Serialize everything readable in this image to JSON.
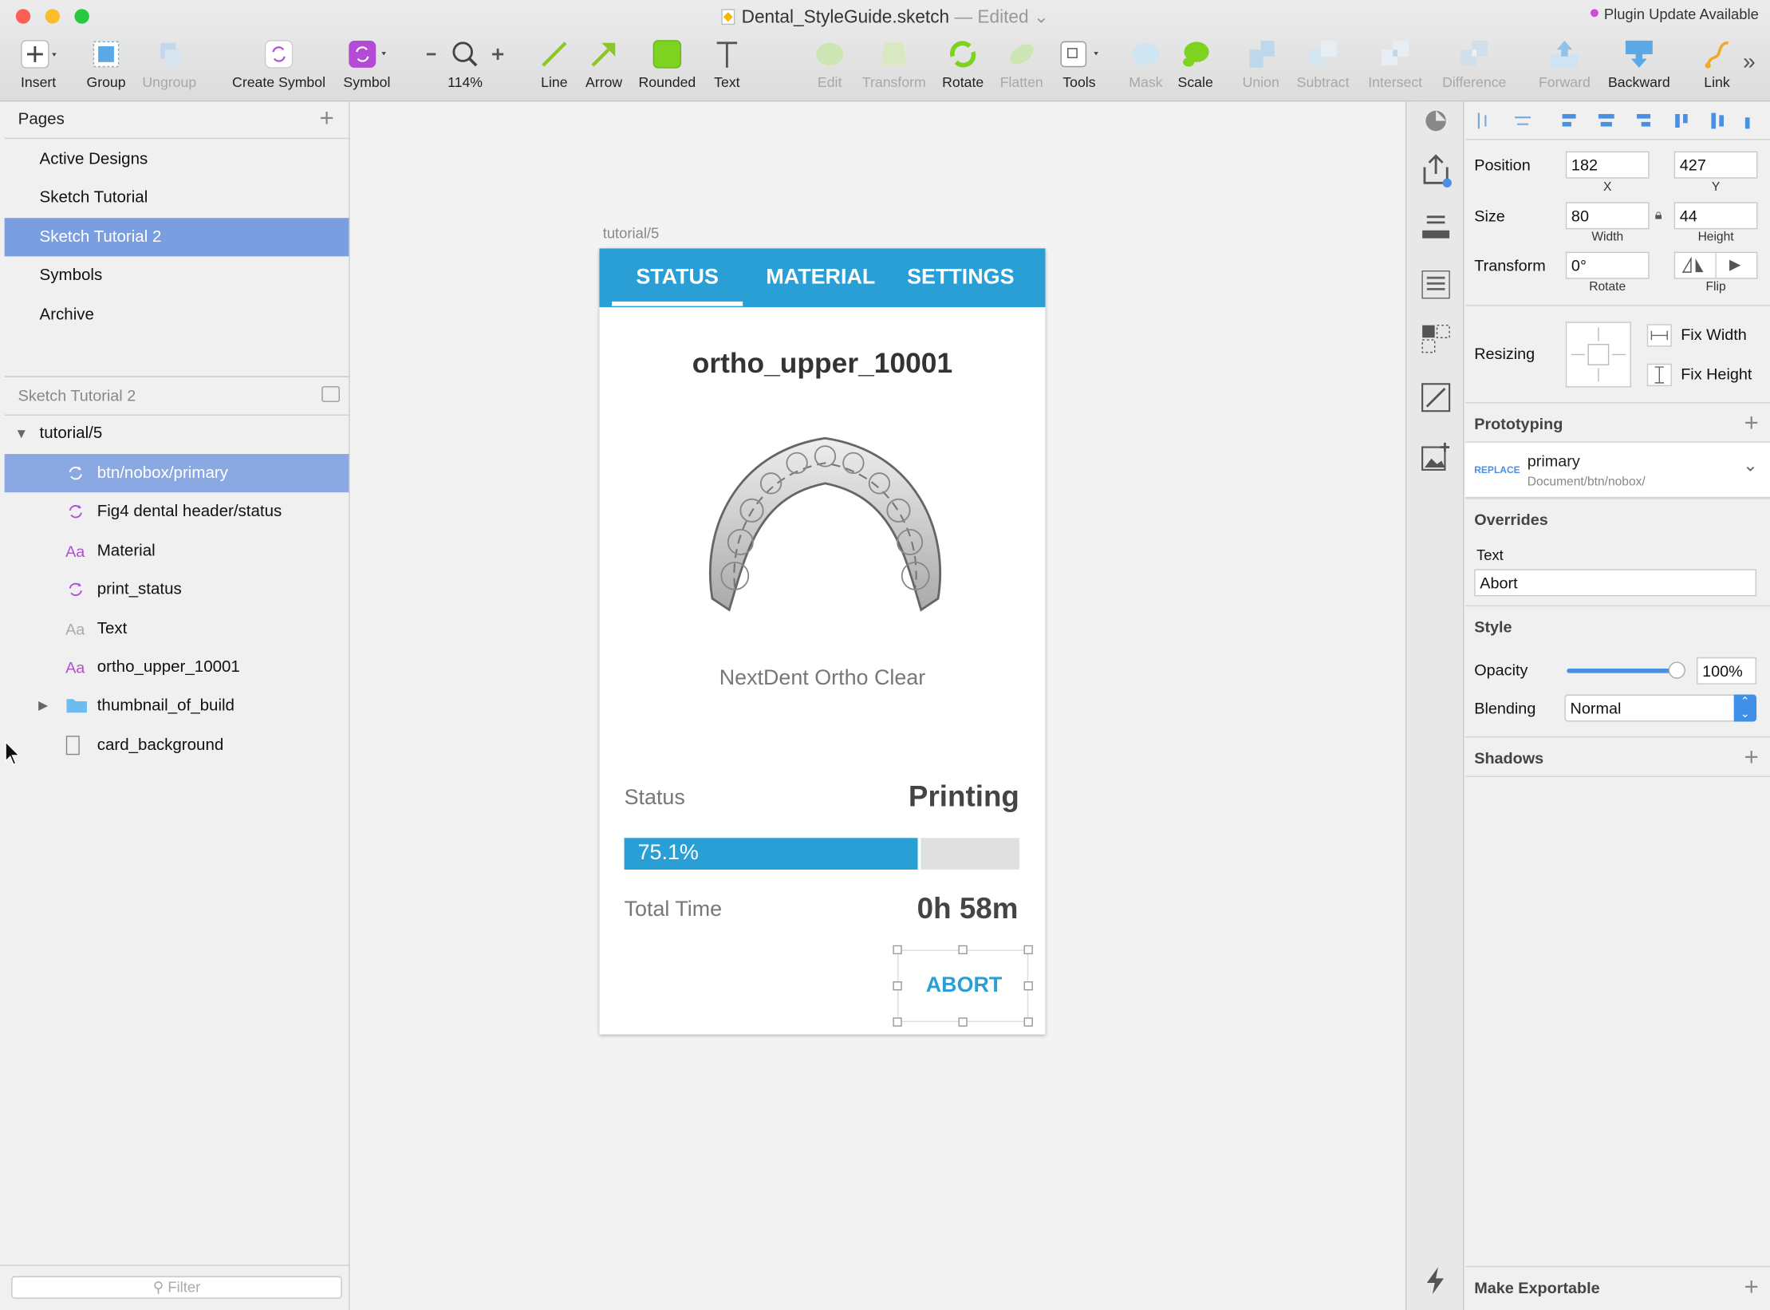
{
  "window": {
    "title": "Dental_StyleGuide.sketch",
    "status": "— Edited",
    "plugin_notice": "Plugin Update Available"
  },
  "toolbar": {
    "insert": "Insert",
    "group": "Group",
    "ungroup": "Ungroup",
    "create_symbol": "Create Symbol",
    "symbol": "Symbol",
    "zoom": "114%",
    "line": "Line",
    "arrow": "Arrow",
    "rounded": "Rounded",
    "text": "Text",
    "edit": "Edit",
    "transform": "Transform",
    "rotate": "Rotate",
    "flatten": "Flatten",
    "tools": "Tools",
    "mask": "Mask",
    "scale": "Scale",
    "union": "Union",
    "subtract": "Subtract",
    "intersect": "Intersect",
    "difference": "Difference",
    "forward": "Forward",
    "backward": "Backward",
    "link": "Link"
  },
  "pages": {
    "header": "Pages",
    "items": [
      "Active Designs",
      "Sketch Tutorial",
      "Sketch Tutorial 2",
      "Symbols",
      "Archive"
    ],
    "selected": "Sketch Tutorial 2"
  },
  "layers": {
    "header": "Sketch Tutorial 2",
    "artboard": "tutorial/5",
    "items": [
      {
        "name": "btn/nobox/primary",
        "icon": "symbol-instance-icon"
      },
      {
        "name": "Fig4 dental header/status",
        "icon": "symbol-instance-icon"
      },
      {
        "name": "Material",
        "icon": "text-layer-icon"
      },
      {
        "name": "print_status",
        "icon": "symbol-instance-icon"
      },
      {
        "name": "Text",
        "icon": "text-layer-icon"
      },
      {
        "name": "ortho_upper_10001",
        "icon": "text-layer-icon"
      },
      {
        "name": "thumbnail_of_build",
        "icon": "folder-icon"
      },
      {
        "name": "card_background",
        "icon": "rectangle-icon"
      }
    ],
    "filter_placeholder": "Filter"
  },
  "artboard": {
    "label": "tutorial/5",
    "tabs": [
      "STATUS",
      "MATERIAL",
      "SETTINGS"
    ],
    "active_tab": "STATUS",
    "title": "ortho_upper_10001",
    "material": "NextDent Ortho Clear",
    "status_label": "Status",
    "status_value": "Printing",
    "progress_text": "75.1%",
    "progress": 0.751,
    "time_label": "Total Time",
    "time_value": "0h 58m",
    "button": "ABORT"
  },
  "inspector": {
    "position_label": "Position",
    "x": "182",
    "y": "427",
    "x_cap": "X",
    "y_cap": "Y",
    "size_label": "Size",
    "width": "80",
    "height": "44",
    "w_cap": "Width",
    "h_cap": "Height",
    "transform_label": "Transform",
    "rotate": "0°",
    "rotate_cap": "Rotate",
    "flip_cap": "Flip",
    "resizing_label": "Resizing",
    "fix_width": "Fix Width",
    "fix_height": "Fix Height",
    "prototyping": "Prototyping",
    "replace_tag": "REPLACE",
    "proto_target": "primary",
    "proto_path": "Document/btn/nobox/",
    "overrides": "Overrides",
    "override_text_label": "Text",
    "override_text_value": "Abort",
    "style": "Style",
    "opacity_label": "Opacity",
    "opacity_value": "100%",
    "opacity": 1.0,
    "blending_label": "Blending",
    "blending_value": "Normal",
    "shadows": "Shadows",
    "make_exportable": "Make Exportable"
  },
  "colors": {
    "accent": "#2a9fd6",
    "selection": "#7b9ee0",
    "symbol": "#b44bd6"
  }
}
